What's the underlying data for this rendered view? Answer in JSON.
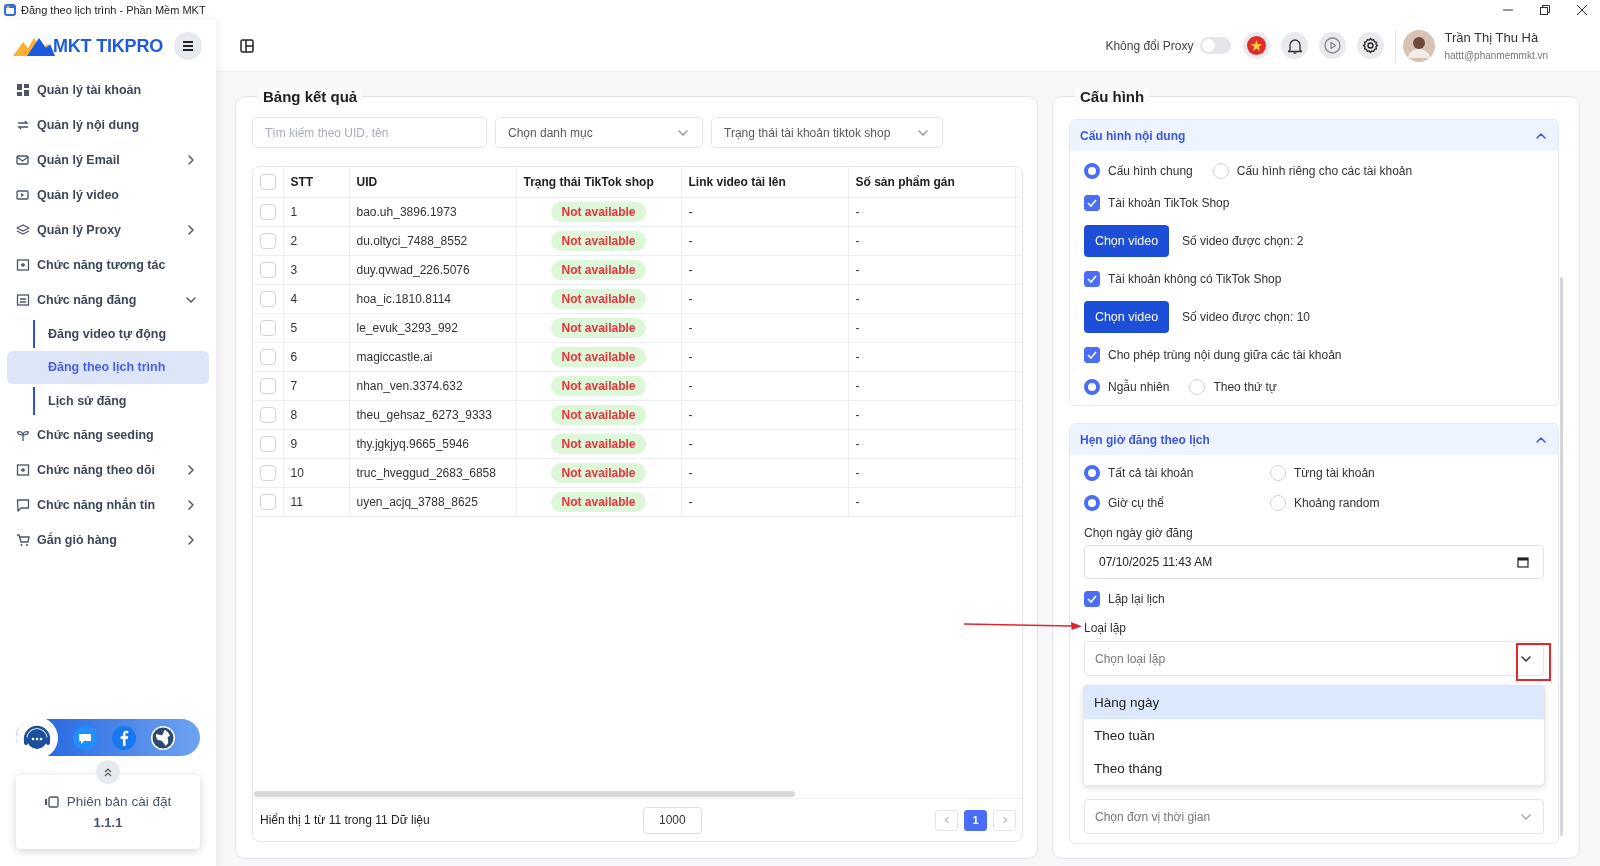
{
  "window": {
    "title": "Đăng theo lịch trình - Phần Mềm MKT"
  },
  "sidebar": {
    "logo": "MKT TIKPRO",
    "items": [
      {
        "label": "Quản lý tài khoản",
        "expandable": false
      },
      {
        "label": "Quản lý nội dung",
        "expandable": false
      },
      {
        "label": "Quản lý Email",
        "expandable": true,
        "expanded": false
      },
      {
        "label": "Quản lý video",
        "expandable": false
      },
      {
        "label": "Quản lý Proxy",
        "expandable": true,
        "expanded": false
      },
      {
        "label": "Chức năng tương tác",
        "expandable": false
      },
      {
        "label": "Chức năng đăng",
        "expandable": true,
        "expanded": true,
        "children": [
          {
            "label": "Đăng video tự động",
            "selected": false
          },
          {
            "label": "Đăng theo lịch trình",
            "selected": true
          },
          {
            "label": "Lịch sử đăng",
            "selected": false
          }
        ]
      },
      {
        "label": "Chức năng seeding",
        "expandable": false
      },
      {
        "label": "Chức năng theo dõi",
        "expandable": true,
        "expanded": false
      },
      {
        "label": "Chức năng nhắn tin",
        "expandable": true,
        "expanded": false
      },
      {
        "label": "Gắn giỏ hàng",
        "expandable": true,
        "expanded": false
      }
    ],
    "version": {
      "label": "Phiên bản cài đặt",
      "number": "1.1.1"
    }
  },
  "header": {
    "proxy_label": "Không đổi Proxy",
    "proxy_on": false,
    "user": {
      "name": "Trần Thị Thu Hà",
      "email": "hattt@phanmemmkt.vn"
    }
  },
  "results": {
    "title": "Bảng kết quả",
    "search": {
      "placeholder": "Tìm kiếm theo UID, tên"
    },
    "filters": [
      {
        "placeholder": "Chọn danh mục"
      },
      {
        "placeholder": "Trạng thái tài khoản tiktok shop"
      }
    ],
    "table": {
      "all_checked": false,
      "columns": [
        "STT",
        "UID",
        "Trạng thái TikTok shop",
        "Link video tải lên",
        "Số sản phẩm gán"
      ],
      "rows": [
        {
          "stt": "1",
          "uid": "bao.uh_3896.1973",
          "status": "Not available",
          "link": "-",
          "products": "-",
          "checked": false
        },
        {
          "stt": "2",
          "uid": "du.oltyci_7488_8552",
          "status": "Not available",
          "link": "-",
          "products": "-",
          "checked": false
        },
        {
          "stt": "3",
          "uid": "duy.qvwad_226.5076",
          "status": "Not available",
          "link": "-",
          "products": "-",
          "checked": false
        },
        {
          "stt": "4",
          "uid": "hoa_ic.1810.8114",
          "status": "Not available",
          "link": "-",
          "products": "-",
          "checked": false
        },
        {
          "stt": "5",
          "uid": "le_evuk_3293_992",
          "status": "Not available",
          "link": "-",
          "products": "-",
          "checked": false
        },
        {
          "stt": "6",
          "uid": "magiccastle.ai",
          "status": "Not available",
          "link": "-",
          "products": "-",
          "checked": false
        },
        {
          "stt": "7",
          "uid": "nhan_ven.3374.632",
          "status": "Not available",
          "link": "-",
          "products": "-",
          "checked": false
        },
        {
          "stt": "8",
          "uid": "theu_gehsaz_6273_9333",
          "status": "Not available",
          "link": "-",
          "products": "-",
          "checked": false
        },
        {
          "stt": "9",
          "uid": "thy.jgkjyq.9665_5946",
          "status": "Not available",
          "link": "-",
          "products": "-",
          "checked": false
        },
        {
          "stt": "10",
          "uid": "truc_hveggud_2683_6858",
          "status": "Not available",
          "link": "-",
          "products": "-",
          "checked": false
        },
        {
          "stt": "11",
          "uid": "uyen_acjq_3788_8625",
          "status": "Not available",
          "link": "-",
          "products": "-",
          "checked": false
        }
      ]
    },
    "footer": {
      "summary": "Hiển thị 1 từ 11 trong 11 Dữ liệu",
      "page_size": "1000",
      "pages": [
        {
          "label": "1",
          "selected": true
        }
      ]
    }
  },
  "config": {
    "title": "Cấu hình",
    "sections": [
      {
        "title": "Cấu hình nội dung",
        "expanded": true,
        "items": [
          {
            "kind": "radios",
            "options": [
              {
                "label": "Cấu hình chung",
                "selected": true
              },
              {
                "label": "Cấu hình riêng cho các tài khoản",
                "selected": false
              }
            ]
          },
          {
            "kind": "checkbox",
            "label": "Tài khoản TikTok Shop",
            "checked": true
          },
          {
            "kind": "picker",
            "button": "Chọn video",
            "count": "Số video được chọn: 2"
          },
          {
            "kind": "checkbox",
            "label": "Tài khoản không có TikTok Shop",
            "checked": true
          },
          {
            "kind": "picker",
            "button": "Chọn video",
            "count": "Số video được chọn: 10"
          },
          {
            "kind": "checkbox",
            "label": "Cho phép trùng nội dung giữa các tài khoản",
            "checked": true
          },
          {
            "kind": "radios",
            "options": [
              {
                "label": "Ngẫu nhiên",
                "selected": true
              },
              {
                "label": "Theo thứ tự",
                "selected": false
              }
            ]
          }
        ]
      },
      {
        "title": "Hẹn giờ đăng theo lịch",
        "expanded": true,
        "items": [
          {
            "kind": "radio_columns",
            "options": [
              {
                "label": "Tất cả tài khoản",
                "selected": true
              },
              {
                "label": "Từng tài khoản",
                "selected": false
              }
            ]
          },
          {
            "kind": "radio_columns",
            "options": [
              {
                "label": "Giờ cụ thể",
                "selected": true
              },
              {
                "label": "Khoảng random",
                "selected": false
              }
            ]
          },
          {
            "kind": "label",
            "text": "Chọn ngày giờ đăng",
            "pointer_arrow": false
          },
          {
            "kind": "datetime",
            "value": "07/10/2025 11:43 AM"
          },
          {
            "kind": "checkbox",
            "label": "Lặp lại lịch",
            "checked": true
          },
          {
            "kind": "label",
            "text": "Loại lặp",
            "pointer_arrow": true
          },
          {
            "kind": "select",
            "placeholder": "Chọn loại lặp",
            "highlighted": true,
            "open": true,
            "options": [
              {
                "label": "Hàng ngày",
                "selected": true
              },
              {
                "label": "Theo tuần",
                "selected": false
              },
              {
                "label": "Theo tháng",
                "selected": false
              }
            ]
          },
          {
            "kind": "select",
            "placeholder": "Chọn đơn vị thời gian",
            "highlighted": false
          }
        ]
      }
    ]
  }
}
